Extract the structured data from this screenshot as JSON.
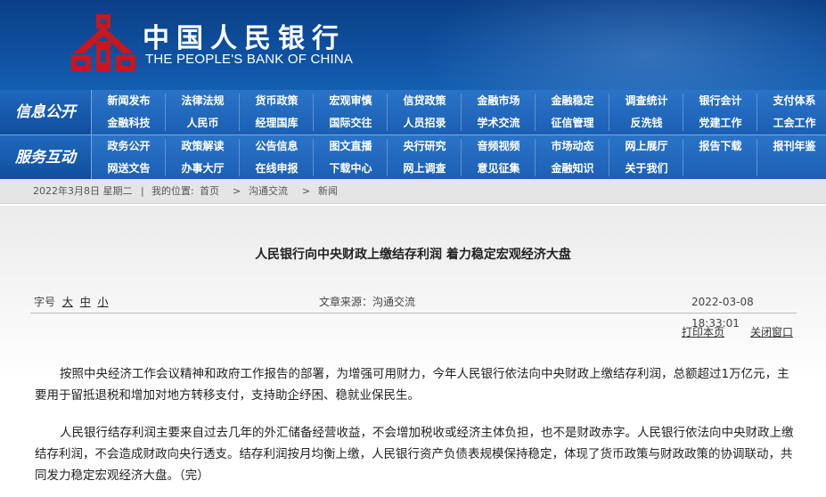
{
  "header": {
    "title_cn": "中国人民银行",
    "title_en": "THE PEOPLE'S BANK OF CHINA",
    "brand_red": "#c8161d",
    "brand_blue": "#0e4f9e"
  },
  "nav": {
    "info_label": "信息公开",
    "service_label": "服务互动",
    "info_row1": [
      "新闻发布",
      "法律法规",
      "货币政策",
      "宏观审慎",
      "信贷政策",
      "金融市场",
      "金融稳定",
      "调查统计",
      "银行会计",
      "支付体系"
    ],
    "info_row2": [
      "金融科技",
      "人民币",
      "经理国库",
      "国际交往",
      "人员招录",
      "学术交流",
      "征信管理",
      "反洗钱",
      "党建工作",
      "工会工作"
    ],
    "service_row1": [
      "政务公开",
      "政策解读",
      "公告信息",
      "图文直播",
      "央行研究",
      "音频视频",
      "市场动态",
      "网上展厅",
      "报告下载",
      "报刊年鉴"
    ],
    "service_row2": [
      "网送文告",
      "办事大厅",
      "在线申报",
      "下载中心",
      "网上调查",
      "意见征集",
      "金融知识",
      "关于我们"
    ]
  },
  "breadcrumb": {
    "date": "2022年3月8日 星期二",
    "location_label": "我的位置:",
    "home": "首页",
    "sep": ">",
    "section": "沟通交流",
    "current": "新闻"
  },
  "article": {
    "title": "人民银行向中央财政上缴结存利润 着力稳定宏观经济大盘",
    "font_size_label": "字号",
    "font_sizes": [
      "大",
      "中",
      "小"
    ],
    "source": "文章来源：沟通交流",
    "datetime": "2022-03-08  18:33:01",
    "print_label": "打印本页",
    "close_label": "关闭窗口",
    "paragraphs": [
      "按照中央经济工作会议精神和政府工作报告的部署，为增强可用财力，今年人民银行依法向中央财政上缴结存利润，总额超过1万亿元，主要用于留抵退税和增加对地方转移支付，支持助企纾困、稳就业保民生。",
      "人民银行结存利润主要来自过去几年的外汇储备经营收益，不会增加税收或经济主体负担，也不是财政赤字。人民银行依法向中央财政上缴结存利润，不会造成财政向央行透支。结存利润按月均衡上缴，人民银行资产负债表规模保持稳定，体现了货币政策与财政政策的协调联动，共同发力稳定宏观经济大盘。（完）"
    ]
  }
}
